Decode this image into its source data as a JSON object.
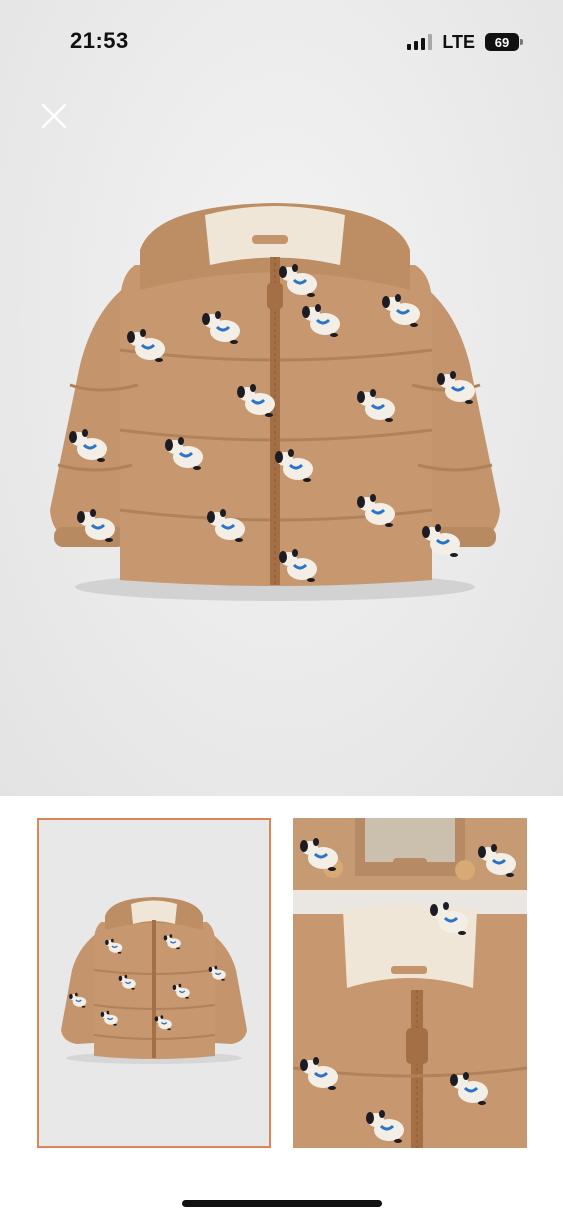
{
  "status_bar": {
    "time": "21:53",
    "network": "LTE",
    "battery": "69"
  },
  "icons": {
    "close": "close-icon",
    "signal": "cellular-signal-icon"
  },
  "colors": {
    "jacket": "#c4946c",
    "selected_thumb_border": "#d9865a"
  }
}
